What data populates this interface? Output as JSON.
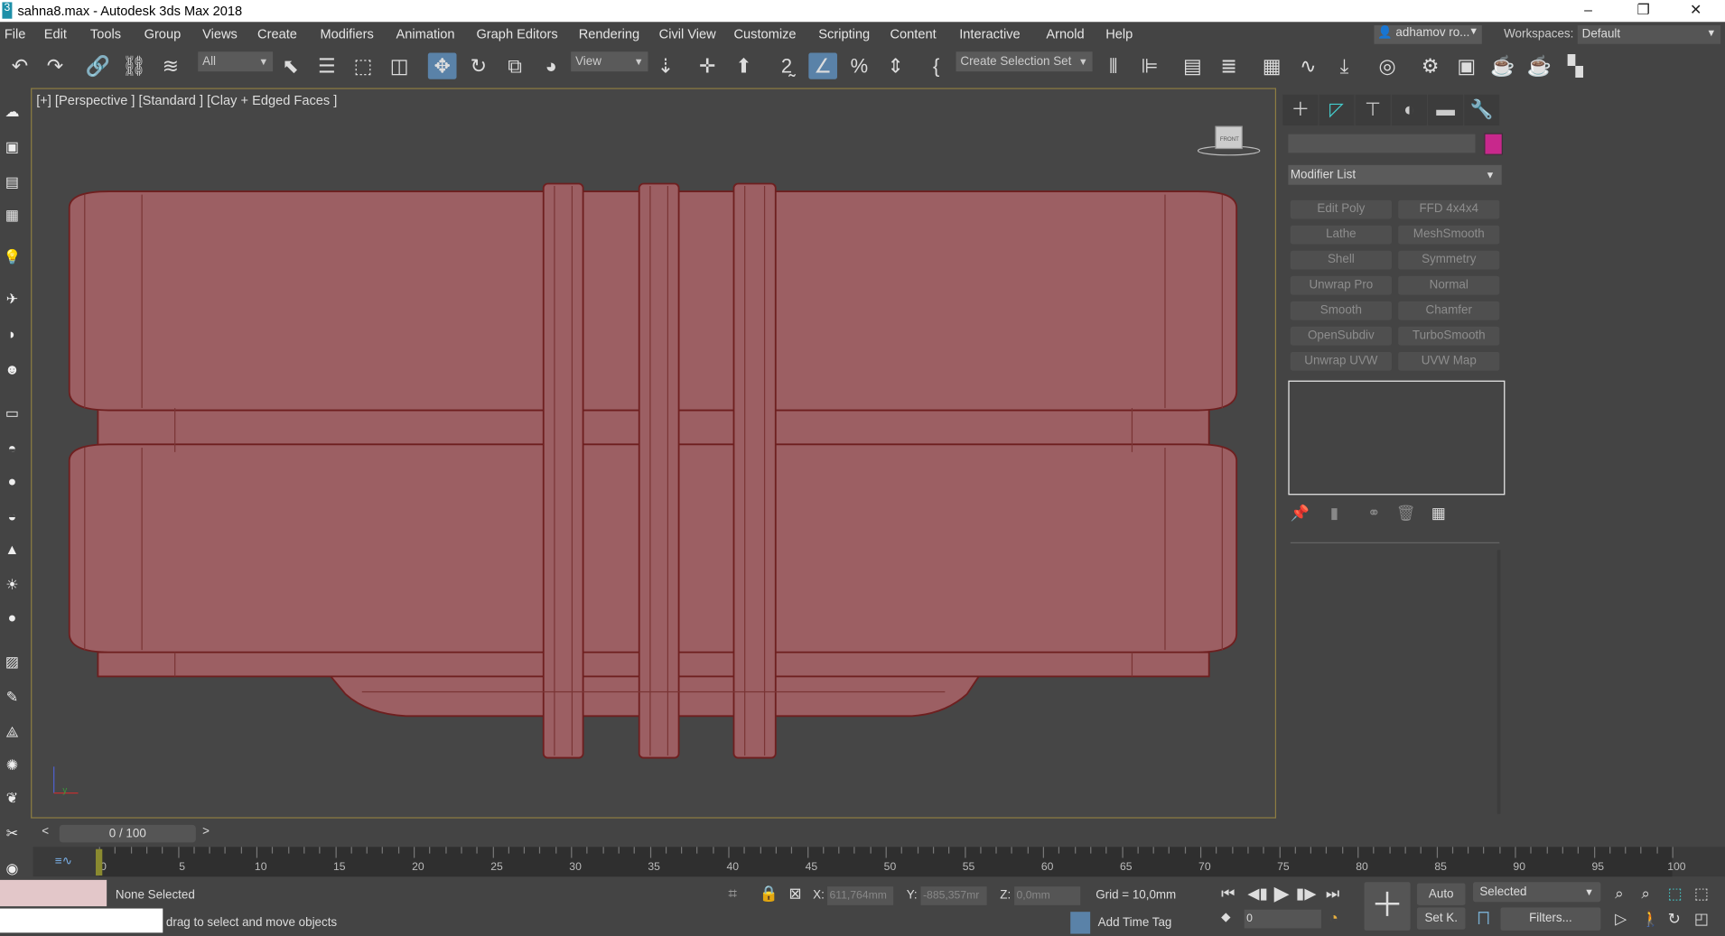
{
  "window": {
    "title": "sahna8.max - Autodesk 3ds Max 2018",
    "app_icon": "3",
    "controls": [
      "–",
      "❐",
      "✕"
    ]
  },
  "menu": [
    "File",
    "Edit",
    "Tools",
    "Group",
    "Views",
    "Create",
    "Modifiers",
    "Animation",
    "Graph Editors",
    "Rendering",
    "Civil View",
    "Customize",
    "Scripting",
    "Content",
    "Interactive",
    "Arnold",
    "Help"
  ],
  "user": {
    "name": "adhamov ro...",
    "workspaces_label": "Workspaces:",
    "workspace": "Default"
  },
  "toolbar": {
    "selection_filter": "All",
    "ref_coord": "View",
    "selection_set": "Create Selection Set"
  },
  "viewport": {
    "label": "[+] [Perspective ] [Standard ] [Clay + Edged Faces ]",
    "viewcube_label": "FRONT",
    "model_color": "#9c5f63",
    "edge_color": "#6e1f1f"
  },
  "command_panel": {
    "tabs": [
      "create",
      "modify",
      "hierarchy",
      "motion",
      "display",
      "utilities"
    ],
    "object_color": "#c8288c",
    "modifier_list": "Modifier List",
    "modifiers": [
      "Edit Poly",
      "FFD 4x4x4",
      "Lathe",
      "MeshSmooth",
      "Shell",
      "Symmetry",
      "Unwrap Pro",
      "Normal",
      "Smooth",
      "Chamfer",
      "OpenSubdiv",
      "TurboSmooth",
      "Unwrap UVW",
      "UVW Map"
    ]
  },
  "timeline": {
    "frame_display": "0 / 100",
    "current_frame": 0,
    "total_frames": 100,
    "labels": [
      "0",
      "5",
      "10",
      "15",
      "20",
      "25",
      "30",
      "35",
      "40",
      "45",
      "50",
      "55",
      "60",
      "65",
      "70",
      "75",
      "80",
      "85",
      "90",
      "95",
      "100"
    ]
  },
  "status": {
    "selection": "None Selected",
    "prompt": "drag to select and move objects",
    "x_label": "X:",
    "x": "611,764mm",
    "y_label": "Y:",
    "y": "-885,357mr",
    "z_label": "Z:",
    "z": "0,0mm",
    "grid": "Grid = 10,0mm",
    "add_time_tag": "Add Time Tag",
    "auto": "Auto",
    "set_key": "Set K.",
    "key_filter": "Selected",
    "filters": "Filters...",
    "frame": "0"
  }
}
